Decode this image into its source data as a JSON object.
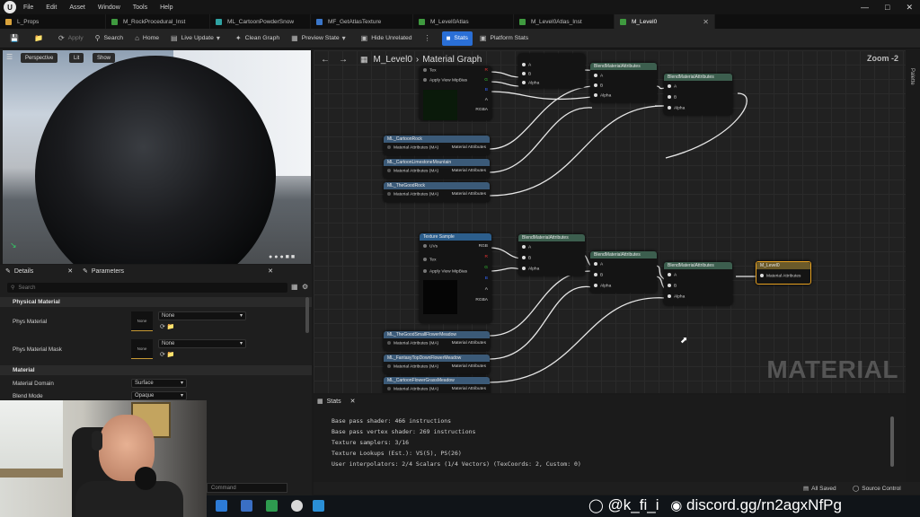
{
  "menu": {
    "items": [
      "File",
      "Edit",
      "Asset",
      "Window",
      "Tools",
      "Help"
    ]
  },
  "tabs": [
    {
      "label": "L_Props",
      "color": "#d9a23b"
    },
    {
      "label": "M_RockProcedural_Inst",
      "color": "#3f9a3f"
    },
    {
      "label": "ML_CartoonPowderSnow",
      "color": "#2fa3a3"
    },
    {
      "label": "MF_GetAtlasTexture",
      "color": "#3a76c9"
    },
    {
      "label": "M_Level0Atlas",
      "color": "#3f9a3f"
    },
    {
      "label": "M_Level0Atlas_Inst",
      "color": "#3f9a3f"
    },
    {
      "label": "M_Level0",
      "color": "#3f9a3f"
    }
  ],
  "toolbar": {
    "apply": "Apply",
    "search": "Search",
    "home": "Home",
    "live_update": "Live Update",
    "clean_graph": "Clean Graph",
    "preview_state": "Preview State",
    "hide_unrelated": "Hide Unrelated",
    "stats": "Stats",
    "platform_stats": "Platform Stats"
  },
  "viewport": {
    "perspective": "Perspective",
    "lit": "Lit",
    "show": "Show"
  },
  "details": {
    "tab_details": "Details",
    "tab_parameters": "Parameters",
    "search_placeholder": "Search",
    "section_physical": "Physical Material",
    "phys_material_label": "Phys Material",
    "phys_material_value": "None",
    "phys_material_thumb": "None",
    "phys_mask_label": "Phys Material Mask",
    "phys_mask_value": "None",
    "phys_mask_thumb": "None",
    "section_material": "Material",
    "domain_label": "Material Domain",
    "domain_value": "Surface",
    "blend_label": "Blend Mode",
    "blend_value": "Opaque"
  },
  "graph": {
    "breadcrumb": "M_Level0",
    "breadcrumb_sub": "Material Graph",
    "zoom": "Zoom -2",
    "watermark": "MATERIAL",
    "palette": "Palette",
    "texture_sample_title": "Texture Sample",
    "pins": {
      "uvs": "UVs",
      "tex": "Tex",
      "apply_view_mip": "Apply View MipBias",
      "rgb": "RGB",
      "r": "R",
      "g": "G",
      "b": "B",
      "a": "A",
      "rgba": "RGBA",
      "alpha": "Alpha",
      "material_attributes": "Material Attributes",
      "material_attributes_ma": "Material Attributes (MA)"
    },
    "blend_title": "BlendMaterialAttributes",
    "top_funcs": [
      "ML_CartoonRock",
      "ML_CartoonLimestoneMountain",
      "ML_TheGoodRock"
    ],
    "bottom_funcs": [
      "ML_TheGoodSmallFlowerMeadow",
      "ML_FantasyTopDownFlowerMeadow",
      "ML_CartoonFlowerGrassMeadow"
    ],
    "output_title": "M_Level0"
  },
  "stats": {
    "title": "Stats",
    "lines": [
      "Base pass shader: 466 instructions",
      "Base pass vertex shader: 269 instructions",
      "Texture samplers: 3/16",
      "Texture Lookups (Est.): VS(5), PS(26)",
      "User interpolators: 2/4 Scalars (1/4 Vectors) (TexCoords: 2, Custom: 0)"
    ]
  },
  "status": {
    "all_saved": "All Saved",
    "source_control": "Source Control",
    "console_placeholder": "Command"
  },
  "overlay": {
    "instagram": "@k_fi_i",
    "discord": "discord.gg/rn2agxNfPg"
  },
  "colors": {
    "accent": "#2a6fd6",
    "selected_border": "#e6a020",
    "texture_header": "#2c5e8c",
    "function_header": "#3b5a78",
    "blend_header": "#3c5e4e",
    "output_header": "#6b5a2a"
  }
}
